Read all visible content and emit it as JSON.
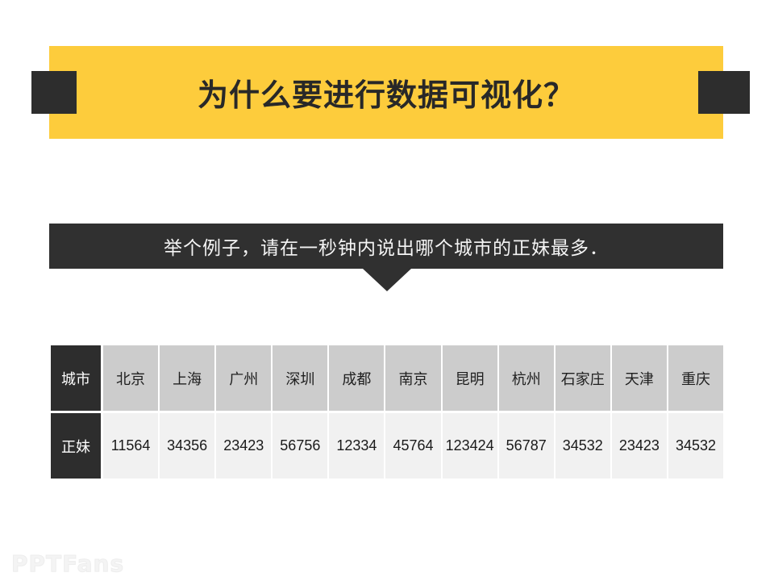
{
  "slide": {
    "title": "为什么要进行数据可视化？",
    "subtitle": "举个例子，请在一秒钟内说出哪个城市的正妹最多．",
    "watermark": "PPTFans",
    "colors": {
      "accent_yellow": "#FDCC3C",
      "dark": "#2D2D2D",
      "callout_dark": "#303030",
      "header_cell": "#CCCCCC",
      "value_cell": "#F1F1F1",
      "background": "#FFFFFF"
    }
  },
  "table": {
    "row_labels": [
      "城市",
      "正妹"
    ],
    "columns": [
      "北京",
      "上海",
      "广州",
      "深圳",
      "成都",
      "南京",
      "昆明",
      "杭州",
      "石家庄",
      "天津",
      "重庆"
    ],
    "values": [
      "11564",
      "34356",
      "23423",
      "56756",
      "12334",
      "45764",
      "123424",
      "56787",
      "34532",
      "23423",
      "34532"
    ]
  },
  "chart_data": {
    "type": "table",
    "title": "为什么要进行数据可视化？",
    "subtitle": "举个例子，请在一秒钟内说出哪个城市的正妹最多．",
    "categories": [
      "北京",
      "上海",
      "广州",
      "深圳",
      "成都",
      "南京",
      "昆明",
      "杭州",
      "石家庄",
      "天津",
      "重庆"
    ],
    "series": [
      {
        "name": "正妹",
        "values": [
          11564,
          34356,
          23423,
          56756,
          12334,
          45764,
          123424,
          56787,
          34532,
          23423,
          34532
        ]
      }
    ],
    "xlabel": "城市",
    "ylabel": "正妹",
    "max_value": 123424,
    "max_category": "昆明",
    "grid": false,
    "legend": "none"
  }
}
